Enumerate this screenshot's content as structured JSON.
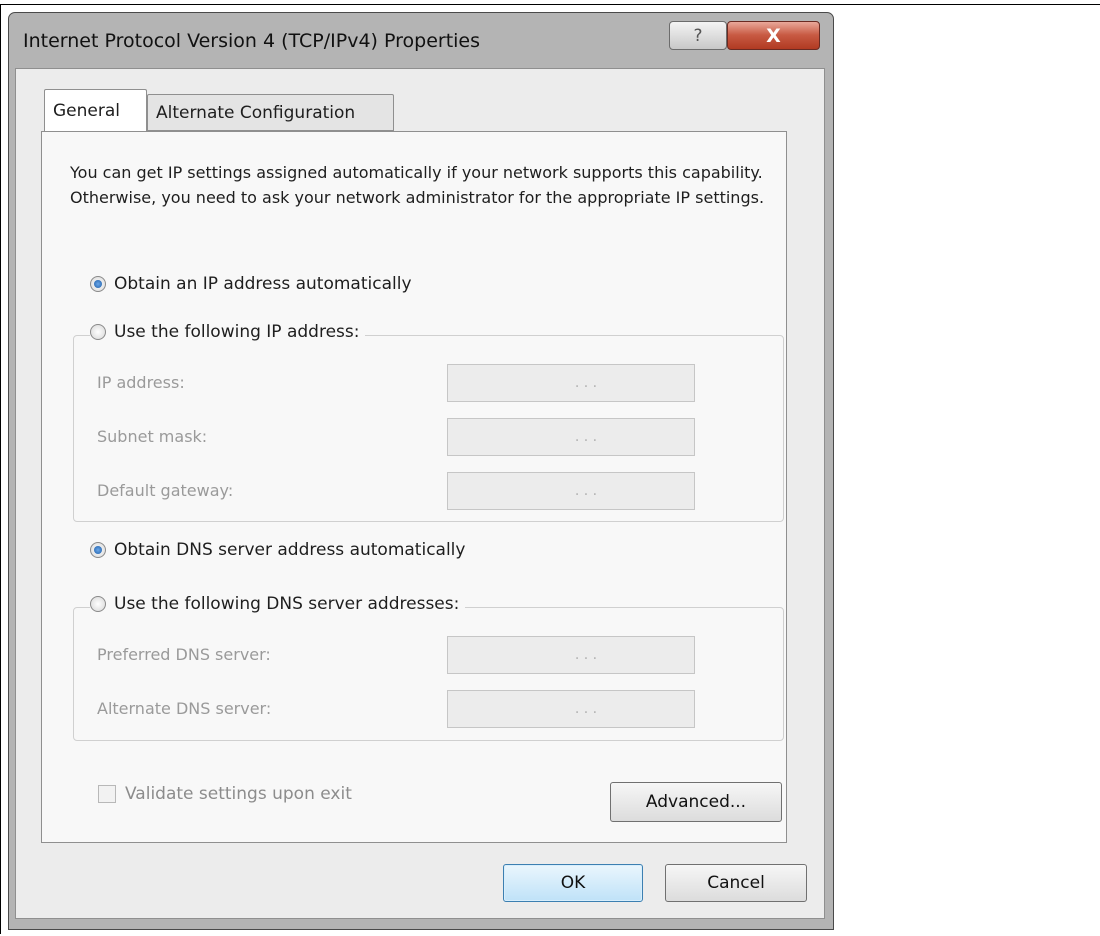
{
  "window": {
    "title": "Internet Protocol Version 4 (TCP/IPv4) Properties",
    "help_label": "?",
    "close_label": "X"
  },
  "tabs": [
    {
      "label": "General",
      "selected": true
    },
    {
      "label": "Alternate Configuration",
      "selected": false
    }
  ],
  "description": "You can get IP settings assigned automatically if your network supports this capability. Otherwise, you need to ask your network administrator for the appropriate IP settings.",
  "ip": {
    "auto_label": "Obtain an IP address automatically",
    "manual_label": "Use the following IP address:",
    "selected": "auto",
    "fields": [
      {
        "label": "IP address:",
        "value": ". . ."
      },
      {
        "label": "Subnet mask:",
        "value": ". . ."
      },
      {
        "label": "Default gateway:",
        "value": ". . ."
      }
    ]
  },
  "dns": {
    "auto_label": "Obtain DNS server address automatically",
    "manual_label": "Use the following DNS server addresses:",
    "selected": "auto",
    "fields": [
      {
        "label": "Preferred DNS server:",
        "value": ". . ."
      },
      {
        "label": "Alternate DNS server:",
        "value": ". . ."
      }
    ]
  },
  "validate_label": "Validate settings upon exit",
  "buttons": {
    "advanced": "Advanced...",
    "ok": "OK",
    "cancel": "Cancel"
  },
  "colors": {
    "close_button": "#c85a43",
    "ok_button": "#bfe2f8",
    "radio_selected": "#1e5ea8"
  }
}
